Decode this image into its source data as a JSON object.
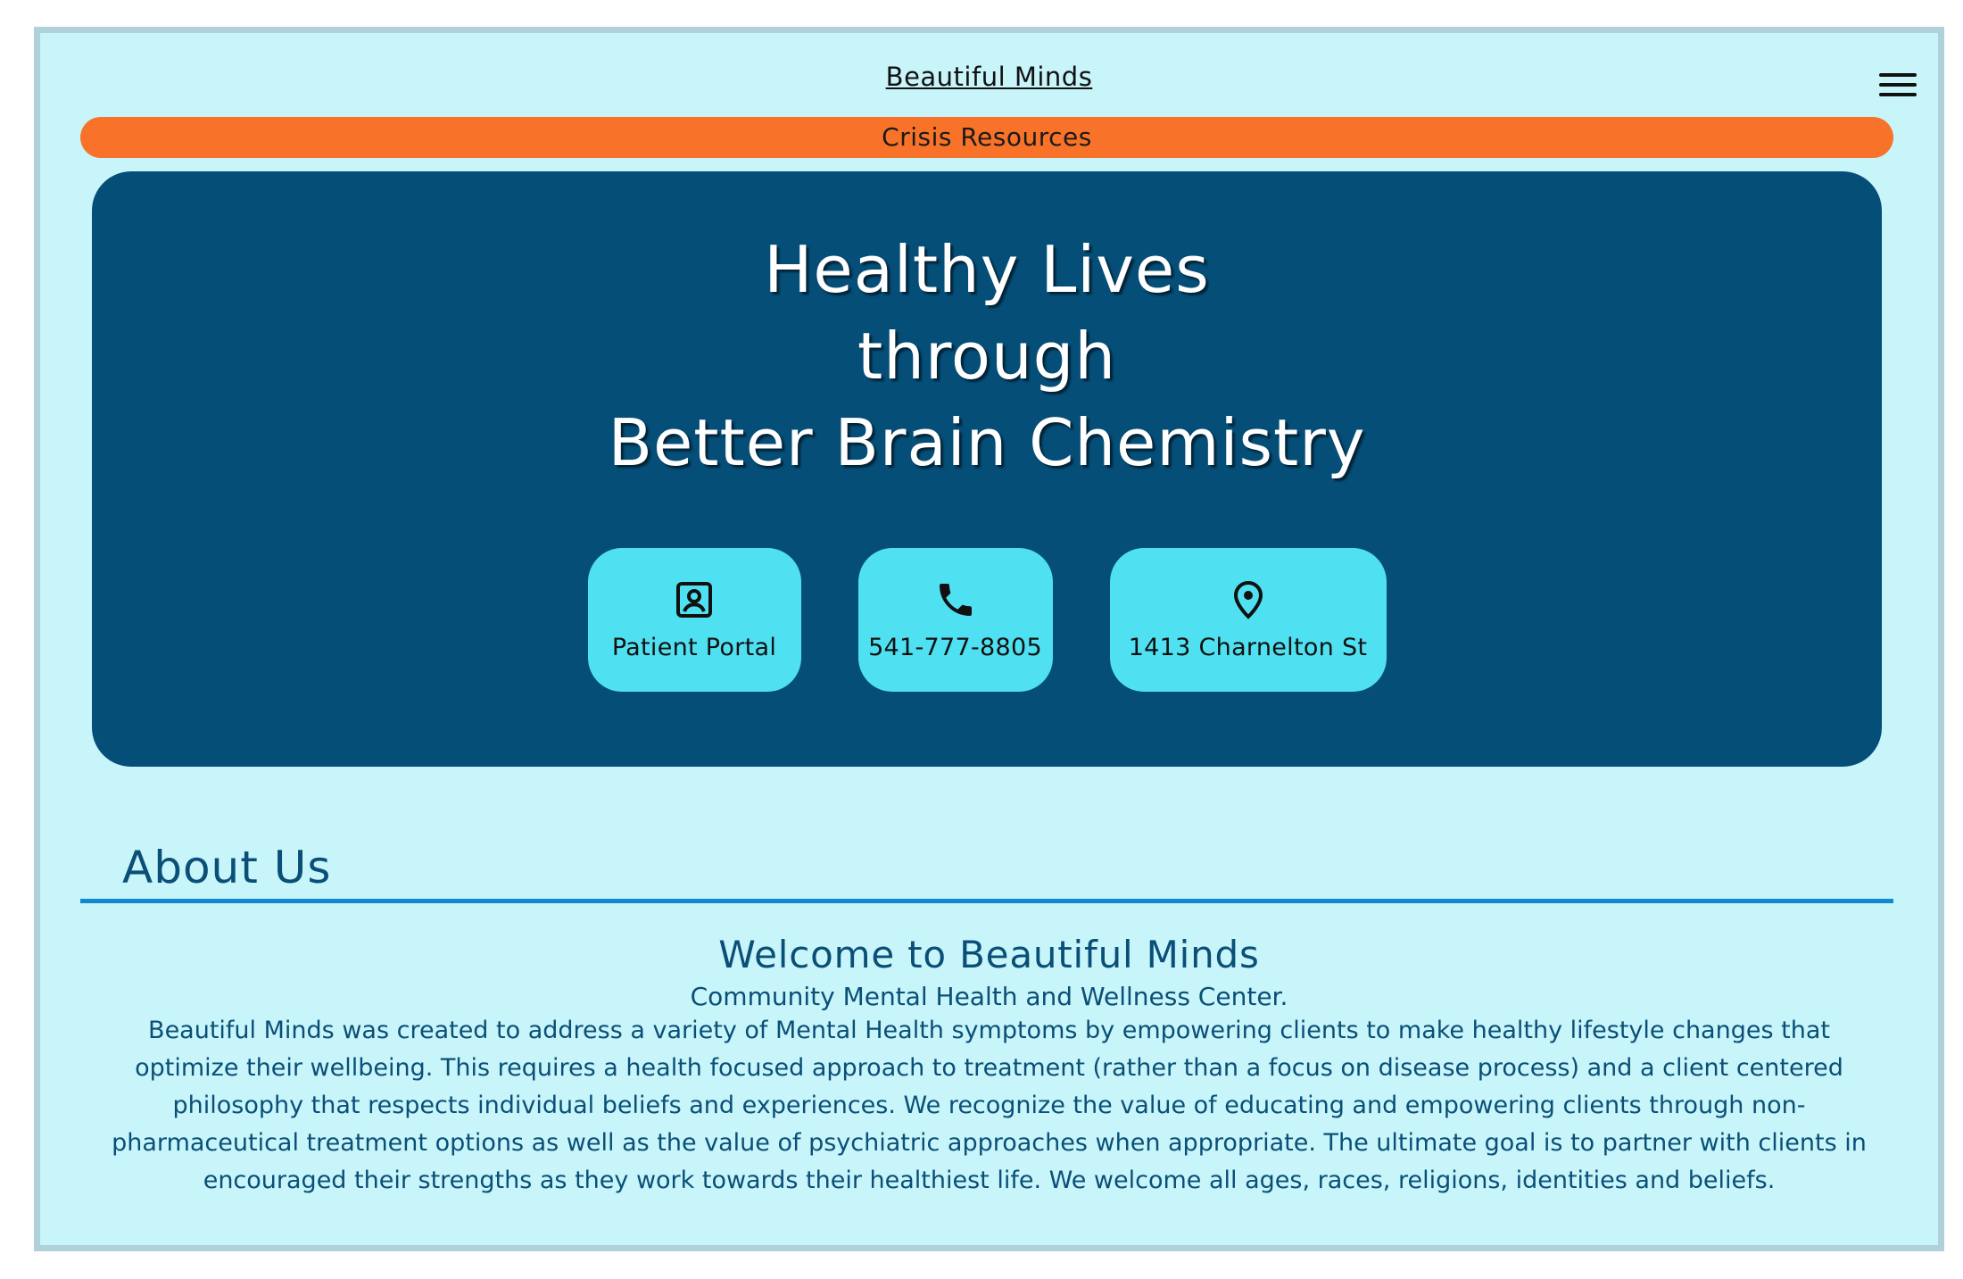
{
  "header": {
    "site_title": "Beautiful Minds",
    "menu_icon": "hamburger-menu-icon",
    "crisis_label": "Crisis Resources"
  },
  "hero": {
    "headline_line1": "Healthy Lives",
    "headline_line2": "through",
    "headline_line3": "Better Brain Chemistry",
    "actions": [
      {
        "label": "Patient Portal",
        "icon": "contact-card-icon"
      },
      {
        "label": "541-777-8805",
        "icon": "phone-icon"
      },
      {
        "label": "1413 Charnelton St",
        "icon": "map-pin-icon"
      }
    ]
  },
  "about": {
    "heading": "About Us",
    "welcome_title": "Welcome to Beautiful Minds",
    "welcome_subtitle": "Community Mental Health and Wellness Center.",
    "body": "Beautiful Minds was created to address a variety of Mental Health symptoms by empowering clients to make healthy lifestyle changes that optimize their wellbeing. This requires a health focused approach to treatment (rather than a focus on disease process) and a client centered philosophy that respects individual beliefs and experiences. We recognize the value of educating and empowering clients through non-pharmaceutical treatment options as well as the value of psychiatric approaches when appropriate. The ultimate goal is to partner with clients in encouraged their strengths as they work towards their healthiest life. We welcome all ages, races, religions, identities and beliefs."
  },
  "colors": {
    "page_background": "#c8f5fa",
    "crisis_bar": "#f87329",
    "hero_background": "#054e78",
    "action_button": "#4fe1f2",
    "accent_text": "#0a4f77",
    "divider": "#0d8ad2"
  }
}
